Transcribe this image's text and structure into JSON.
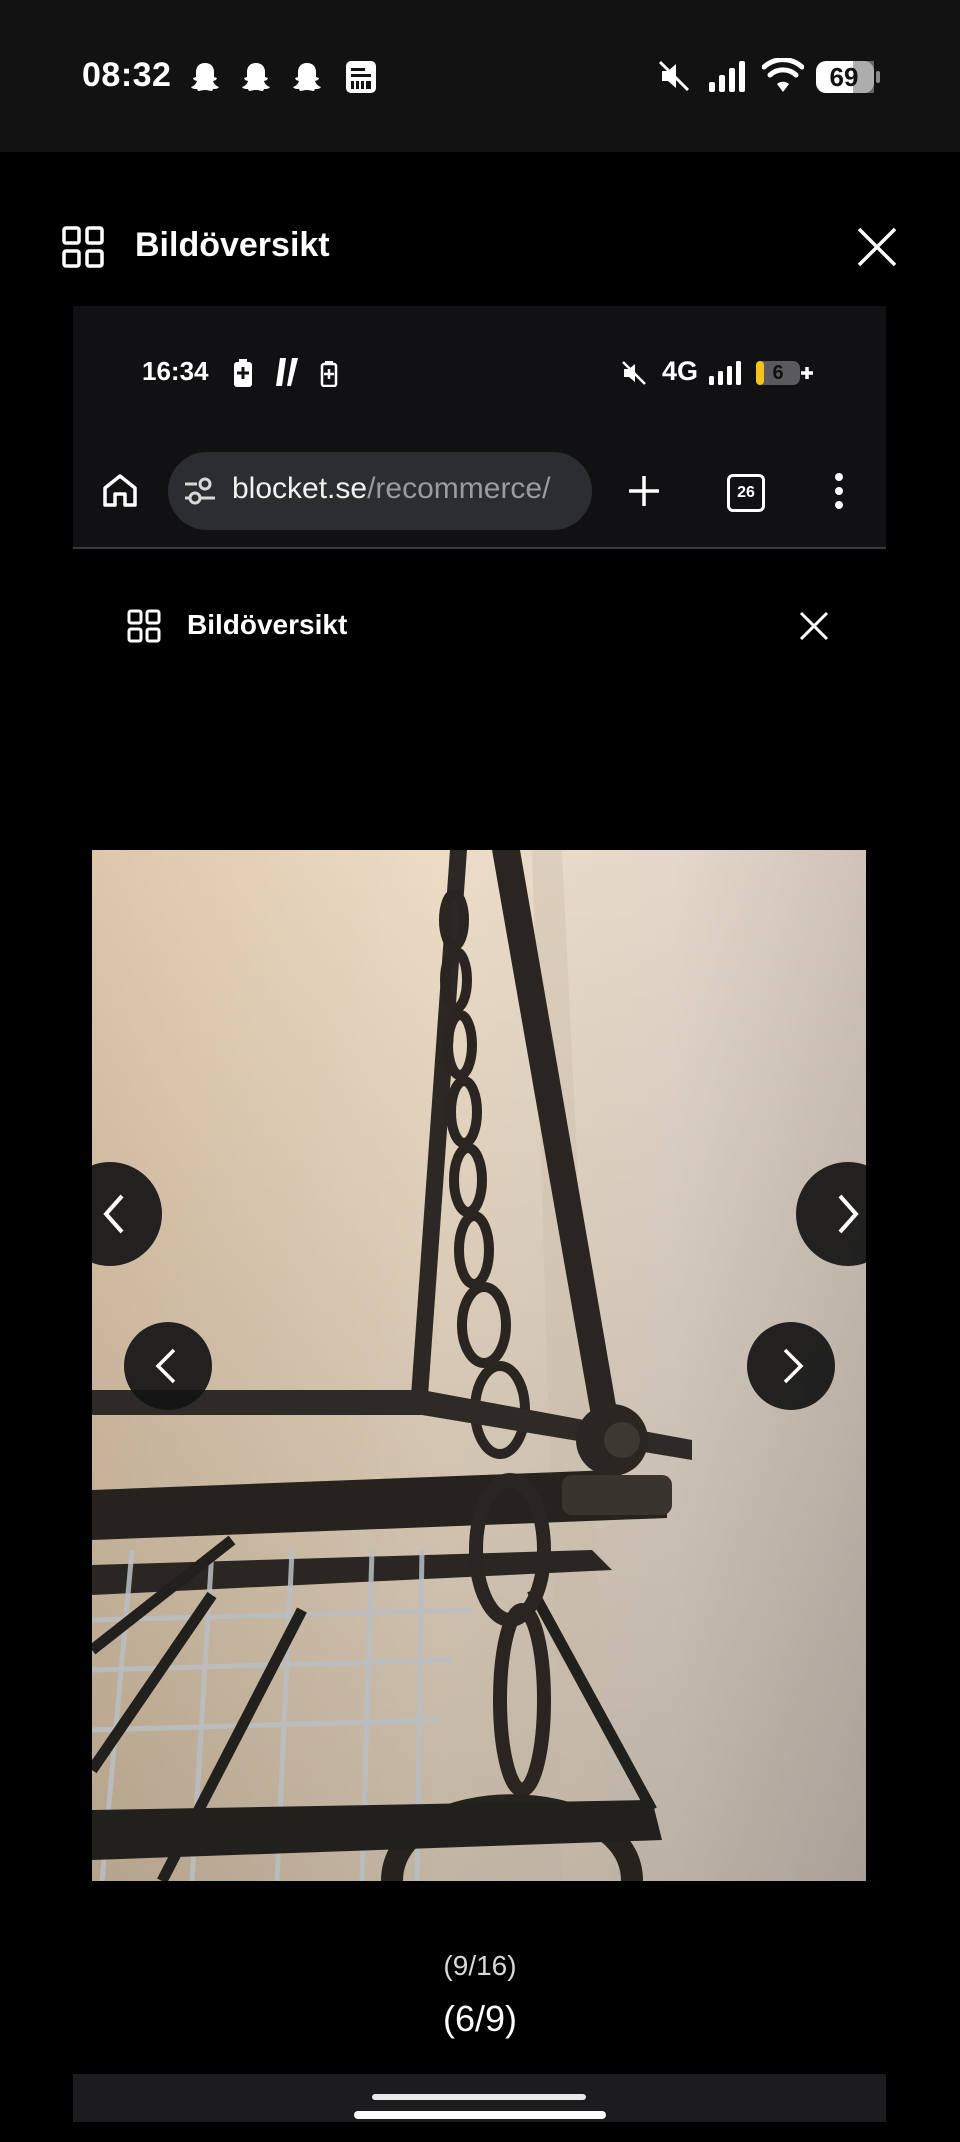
{
  "outer_status": {
    "time": "08:32",
    "battery": "69",
    "icons": [
      "snapchat-icon",
      "snapchat-icon",
      "snapchat-icon",
      "news-icon",
      "mute-icon",
      "signal-icon",
      "wifi-icon",
      "battery-icon"
    ]
  },
  "outer_header": {
    "title": "Bildöversikt",
    "grid_icon": "grid-icon",
    "close_icon": "close-icon"
  },
  "inner_status": {
    "time": "16:34",
    "network": "4G",
    "battery": "6",
    "icons": [
      "battery-saver-icon",
      "app-icon",
      "battery-small-icon",
      "mute-icon",
      "signal-icon",
      "battery-icon"
    ]
  },
  "browser": {
    "url_host": "blocket.se",
    "url_path": "/recommerce/",
    "tab_count": "26",
    "icons": [
      "home-icon",
      "site-settings-icon",
      "new-tab-icon",
      "tabs-icon",
      "more-icon"
    ]
  },
  "inner_header": {
    "title": "Bildöversikt"
  },
  "gallery": {
    "inner_counter": "(9/16)",
    "outer_counter": "(6/9)",
    "photo": "hanging-metal-rack-photo"
  },
  "colors": {
    "background": "#000000",
    "status_bar": "#121212",
    "url_bar": "#2c2d31",
    "nav_button": "#141414"
  }
}
